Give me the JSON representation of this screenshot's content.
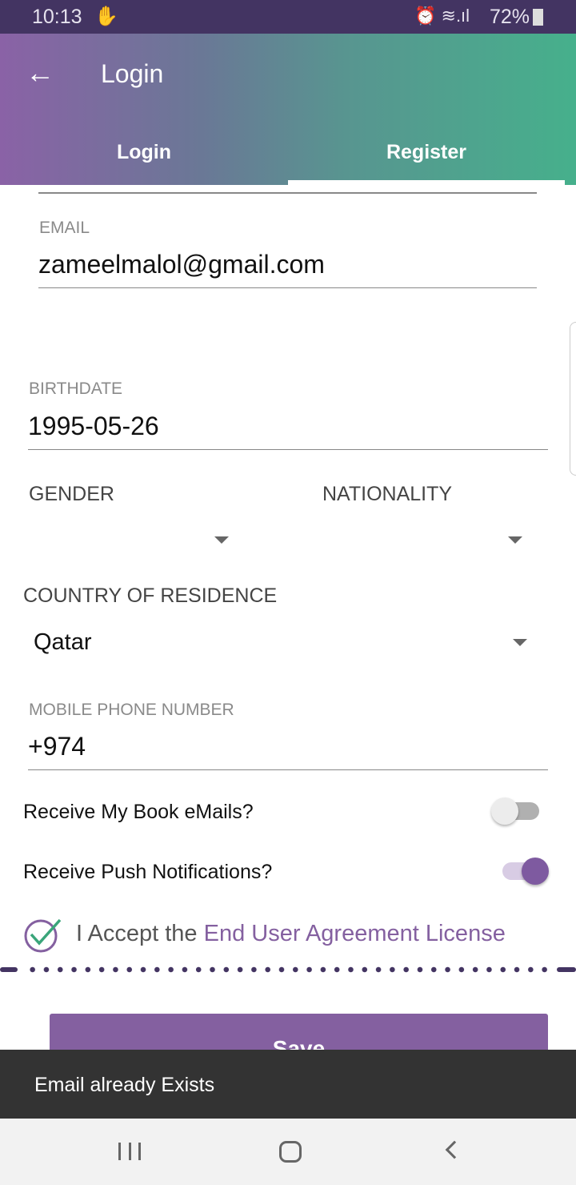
{
  "status_bar": {
    "time": "10:13",
    "battery": "72%"
  },
  "app_bar": {
    "title": "Login",
    "tabs": [
      {
        "label": "Login"
      },
      {
        "label": "Register"
      }
    ],
    "active_tab": "Register"
  },
  "form": {
    "email": {
      "label": "EMAIL",
      "value": "zameelmalol@gmail.com"
    },
    "birthdate": {
      "label": "BIRTHDATE",
      "value": "1995-05-26"
    },
    "gender": {
      "label": "GENDER",
      "value": ""
    },
    "nationality": {
      "label": "NATIONALITY",
      "value": ""
    },
    "country": {
      "label": "COUNTRY OF RESIDENCE",
      "value": "Qatar"
    },
    "phone": {
      "label": "MOBILE PHONE NUMBER",
      "value": "+974"
    },
    "book_emails": {
      "label": "Receive My Book eMails?",
      "on": false
    },
    "push": {
      "label": "Receive Push Notifications?",
      "on": true
    },
    "agreement": {
      "prefix": "I Accept the",
      "link": "End User Agreement License",
      "checked": true
    },
    "save_label": "Save"
  },
  "snackbar": {
    "message": "Email already Exists"
  },
  "colors": {
    "accent": "#8460a0",
    "status_bg": "#433462",
    "check": "#3aa57a"
  }
}
